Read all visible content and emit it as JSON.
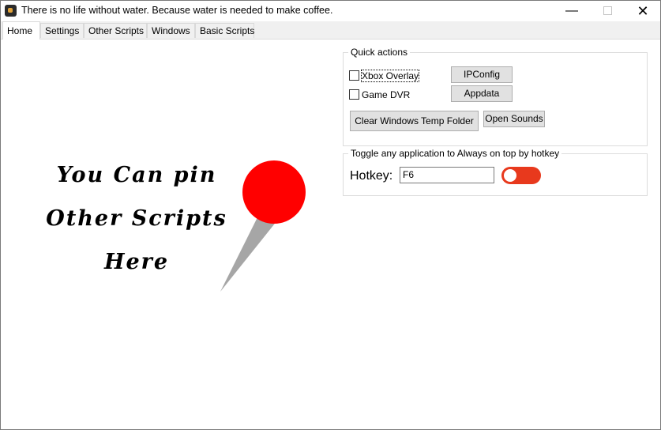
{
  "window": {
    "title": "There is no life without water. Because water is needed to make coffee.",
    "minimize_glyph": "—",
    "close_glyph": "✕"
  },
  "tabs": [
    {
      "label": "Home",
      "active": true
    },
    {
      "label": "Settings"
    },
    {
      "label": "Other Scripts"
    },
    {
      "label": "Windows"
    },
    {
      "label": "Basic Scripts"
    }
  ],
  "quick_actions": {
    "legend": "Quick actions",
    "checkboxes": [
      {
        "label": "Xbox Overlay",
        "checked": false
      },
      {
        "label": "Game DVR",
        "checked": false
      }
    ],
    "buttons": {
      "ipconfig": "IPConfig",
      "appdata": "Appdata",
      "clear_temp": "Clear Windows Temp Folder",
      "open_sounds": "Open Sounds"
    }
  },
  "always_on_top": {
    "legend": "Toggle any application to Always on top by hotkey",
    "hotkey_label": "Hotkey:",
    "hotkey_value": "F6",
    "toggle_on": false,
    "toggle_color": "#e8391d"
  },
  "pin_area": {
    "lines": [
      "You Can pin",
      "Other Scripts",
      "Here"
    ],
    "pin_head_color": "#ff0000",
    "pin_needle_color": "#a6a6a6"
  }
}
